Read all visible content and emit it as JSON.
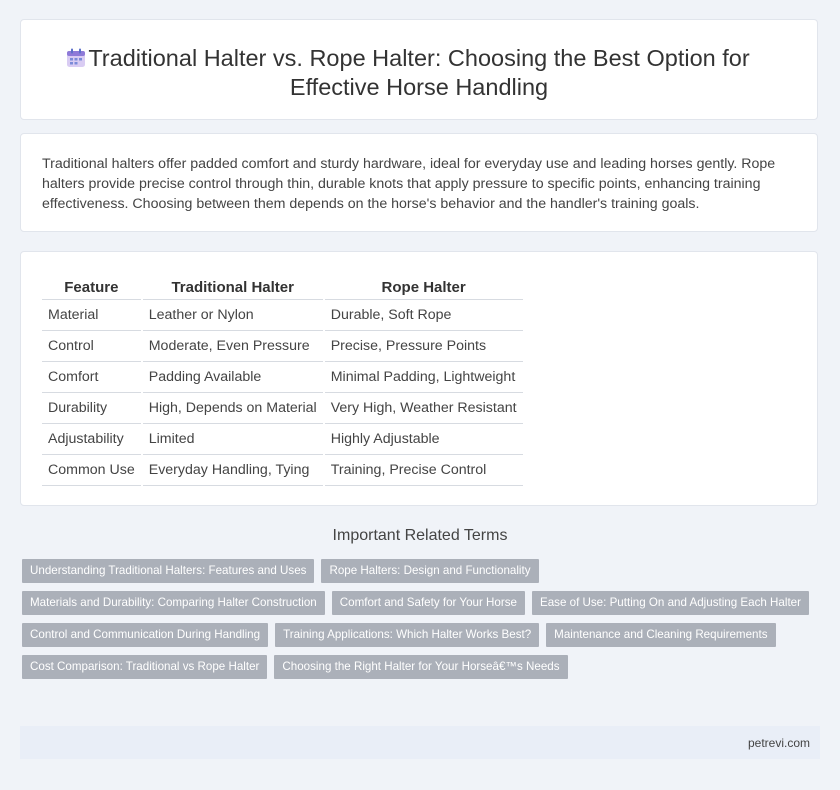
{
  "header": {
    "title_line1": "Traditional Halter vs. Rope Halter: Choosing the Best Option for",
    "title_line2": "Effective Horse Handling",
    "icon": "calendar-icon"
  },
  "intro": {
    "text": "Traditional halters offer padded comfort and sturdy hardware, ideal for everyday use and leading horses gently. Rope halters provide precise control through thin, durable knots that apply pressure to specific points, enhancing training effectiveness. Choosing between them depends on the horse's behavior and the handler's training goals."
  },
  "table": {
    "headers": [
      "Feature",
      "Traditional Halter",
      "Rope Halter"
    ],
    "rows": [
      [
        "Material",
        "Leather or Nylon",
        "Durable, Soft Rope"
      ],
      [
        "Control",
        "Moderate, Even Pressure",
        "Precise, Pressure Points"
      ],
      [
        "Comfort",
        "Padding Available",
        "Minimal Padding, Lightweight"
      ],
      [
        "Durability",
        "High, Depends on Material",
        "Very High, Weather Resistant"
      ],
      [
        "Adjustability",
        "Limited",
        "Highly Adjustable"
      ],
      [
        "Common Use",
        "Everyday Handling, Tying",
        "Training, Precise Control"
      ]
    ]
  },
  "related": {
    "title": "Important Related Terms",
    "tags": [
      "Understanding Traditional Halters: Features and Uses",
      "Rope Halters: Design and Functionality",
      "Materials and Durability: Comparing Halter Construction",
      "Comfort and Safety for Your Horse",
      "Ease of Use: Putting On and Adjusting Each Halter",
      "Control and Communication During Handling",
      "Training Applications: Which Halter Works Best?",
      "Maintenance and Cleaning Requirements",
      "Cost Comparison: Traditional vs Rope Halter",
      "Choosing the Right Halter for Your Horseâ€™s Needs"
    ]
  },
  "footer": {
    "site": "petrevi.com"
  }
}
